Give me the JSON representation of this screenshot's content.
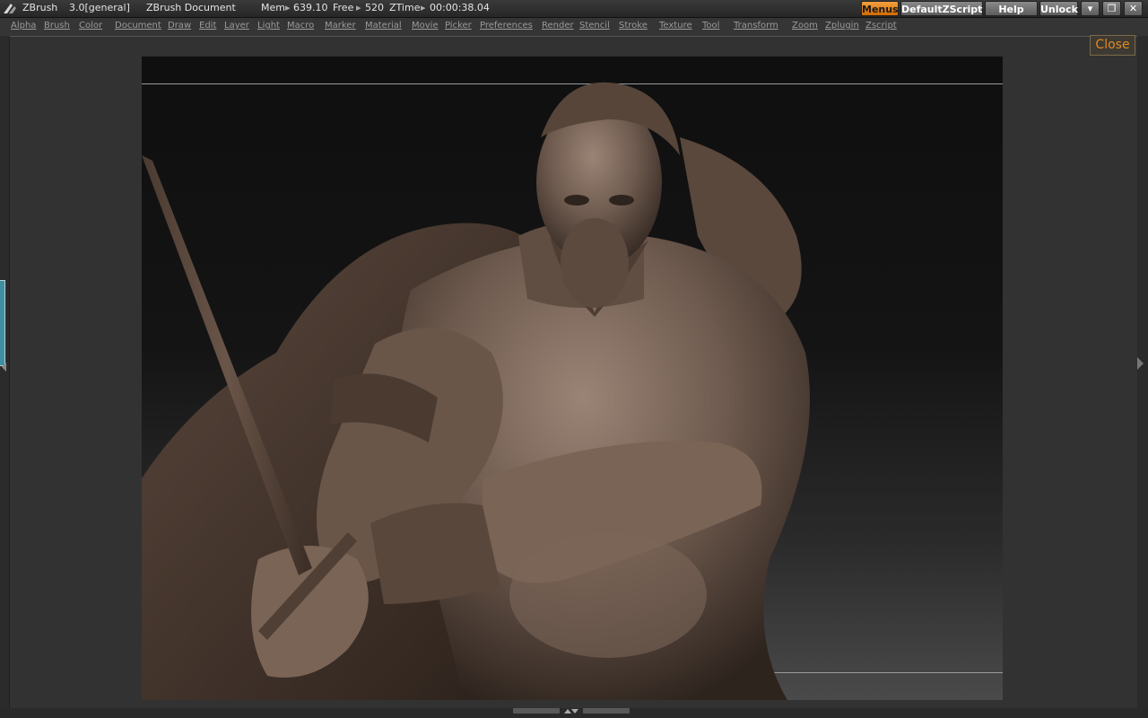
{
  "titlebar": {
    "app_name": "ZBrush",
    "version": "3.0[general]",
    "document": "ZBrush Document",
    "mem_label": "Mem",
    "mem_value": "639.10",
    "free_label": "Free",
    "free_value": "520",
    "ztime_label": "ZTime",
    "ztime_value": "00:00:38.04",
    "buttons": {
      "menus": "Menus",
      "defaultzscript": "DefaultZScript",
      "help": "Help",
      "unlock": "Unlock"
    }
  },
  "menubar": {
    "items": [
      "Alpha",
      "Brush",
      "Color",
      "Document",
      "Draw",
      "Edit",
      "Layer",
      "Light",
      "Macro",
      "Marker",
      "Material",
      "Movie",
      "Picker",
      "Preferences",
      "Render",
      "Stencil",
      "Stroke",
      "Texture",
      "Tool",
      "Transform",
      "Zoom",
      "Zplugin",
      "Zscript"
    ]
  },
  "workarea": {
    "close_label": "Close"
  },
  "colors": {
    "accent": "#e08a1e",
    "clay": "#6e5a4e"
  },
  "icons": [
    "zbrush-logo-icon",
    "minimize-icon",
    "restore-icon",
    "close-icon"
  ]
}
